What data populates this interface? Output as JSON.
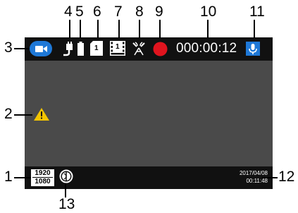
{
  "callouts": {
    "n1": "1",
    "n2": "2",
    "n3": "3",
    "n4": "4",
    "n5": "5",
    "n6": "6",
    "n7": "7",
    "n8": "8",
    "n9": "9",
    "n10": "10",
    "n11": "11",
    "n12": "12",
    "n13": "13"
  },
  "status_bar": {
    "mode_icon": "video-camera-icon",
    "parking_icon": "plug-icon",
    "battery_icon": "battery-icon",
    "sd_card_number": "1",
    "loop_card_number": "1",
    "gps_icon": "satellite-signal-icon",
    "record_icon": "record-dot-icon",
    "timer": "000:00:12",
    "mic_icon": "microphone-icon"
  },
  "main": {
    "warning_icon": "warning-triangle-icon"
  },
  "bottom_bar": {
    "resolution_top": "1920",
    "resolution_bottom": "1080",
    "wdr_icon": "wdr-icon",
    "date": "2017/04/08",
    "time": "00:11:48"
  },
  "colors": {
    "screen": "#4a4a4a",
    "bar": "#111111",
    "accent_blue": "#1e78d7",
    "record_red": "#e0141e",
    "warning_yellow": "#f2c400"
  }
}
